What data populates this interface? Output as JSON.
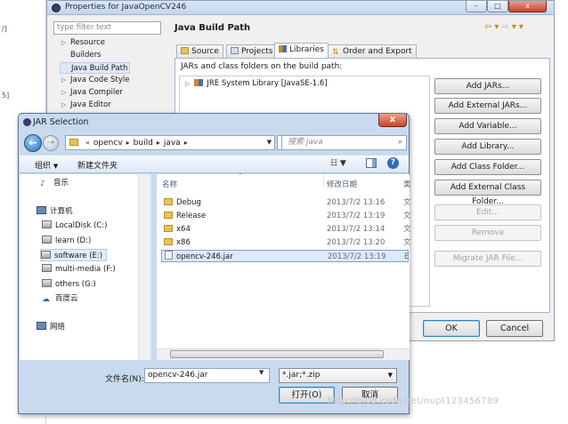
{
  "background": {
    "fragments": [
      "/]",
      "5]"
    ]
  },
  "properties": {
    "title": "Properties for JavaOpenCV246",
    "filter_placeholder": "type filter text",
    "tree": [
      {
        "label": "Resource",
        "expandable": true
      },
      {
        "label": "Builders",
        "expandable": false
      },
      {
        "label": "Java Build Path",
        "expandable": false,
        "selected": true
      },
      {
        "label": "Java Code Style",
        "expandable": true
      },
      {
        "label": "Java Compiler",
        "expandable": true
      },
      {
        "label": "Java Editor",
        "expandable": true
      }
    ],
    "page_title": "Java Build Path",
    "tabs": [
      "Source",
      "Projects",
      "Libraries",
      "Order and Export"
    ],
    "active_tab": "Libraries",
    "jars_label": "JARs and class folders on the build path:",
    "jre_entry": "JRE System Library [JavaSE-1.6]",
    "buttons": [
      "Add JARs...",
      "Add External JARs...",
      "Add Variable...",
      "Add Library...",
      "Add Class Folder...",
      "Add External Class Folder...",
      "Edit...",
      "Remove",
      "Migrate JAR File..."
    ],
    "ok_label": "OK",
    "cancel_label": "Cancel"
  },
  "dialog": {
    "title": "JAR Selection",
    "close_glyph": "x",
    "breadcrumb": [
      "opencv",
      "build",
      "java"
    ],
    "search_placeholder": "搜索 java",
    "organize_label": "组织",
    "new_folder_label": "新建文件夹",
    "nav_items": [
      {
        "label": "音乐",
        "icon": "music-icon"
      },
      {
        "label": "计算机",
        "icon": "computer-icon"
      },
      {
        "label": "LocalDisk (C:)",
        "icon": "drive-icon"
      },
      {
        "label": "learn (D:)",
        "icon": "drive-icon"
      },
      {
        "label": "software (E:)",
        "icon": "drive-icon",
        "selected": true
      },
      {
        "label": "multi-media (F:)",
        "icon": "drive-icon"
      },
      {
        "label": "others (G:)",
        "icon": "drive-icon"
      },
      {
        "label": "百度云",
        "icon": "cloud-icon"
      },
      {
        "label": "网络",
        "icon": "network-icon"
      }
    ],
    "columns": {
      "name": "名称",
      "modified": "修改日期",
      "type": "类"
    },
    "files": [
      {
        "name": "Debug",
        "date": "2013/7/2 13:16",
        "type": "文",
        "kind": "folder"
      },
      {
        "name": "Release",
        "date": "2013/7/2 13:19",
        "type": "文",
        "kind": "folder"
      },
      {
        "name": "x64",
        "date": "2013/7/2 13:14",
        "type": "文",
        "kind": "folder"
      },
      {
        "name": "x86",
        "date": "2013/7/2 13:20",
        "type": "文",
        "kind": "folder"
      },
      {
        "name": "opencv-246.jar",
        "date": "2013/7/2 13:19",
        "type": "E",
        "kind": "jar",
        "selected": true
      }
    ],
    "filename_label": "文件名(N):",
    "filename_value": "opencv-246.jar",
    "filter_value": "*.jar;*.zip",
    "open_label": "打开(O)",
    "cancel_label": "取消"
  },
  "watermark": "http://blog.csdn.net/nupt123456789"
}
